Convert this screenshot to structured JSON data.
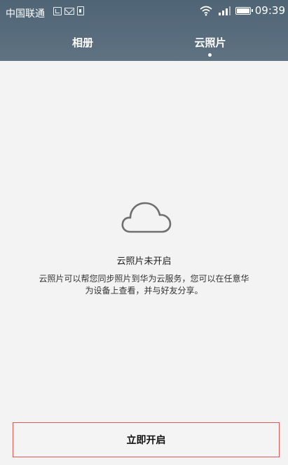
{
  "status_bar": {
    "carrier": "中国联通",
    "time": "09:39",
    "icons": [
      "image-notification-icon",
      "mail-icon",
      "sim-icon",
      "wifi-icon",
      "signal-icon",
      "battery-icon"
    ]
  },
  "tabs": [
    {
      "label": "相册",
      "selected": false
    },
    {
      "label": "云照片",
      "selected": true
    }
  ],
  "empty_state": {
    "icon": "cloud-icon",
    "title": "云照片未开启",
    "description_line1": "云照片可以帮您同步照片到华为云服务，您可以在任意华",
    "description_line2": "为设备上查看，并与好友分享。"
  },
  "action": {
    "enable_label": "立即开启"
  },
  "colors": {
    "header_bg": "#52677a",
    "content_bg": "#f3f3f3",
    "highlight_border": "#e05a5a"
  }
}
